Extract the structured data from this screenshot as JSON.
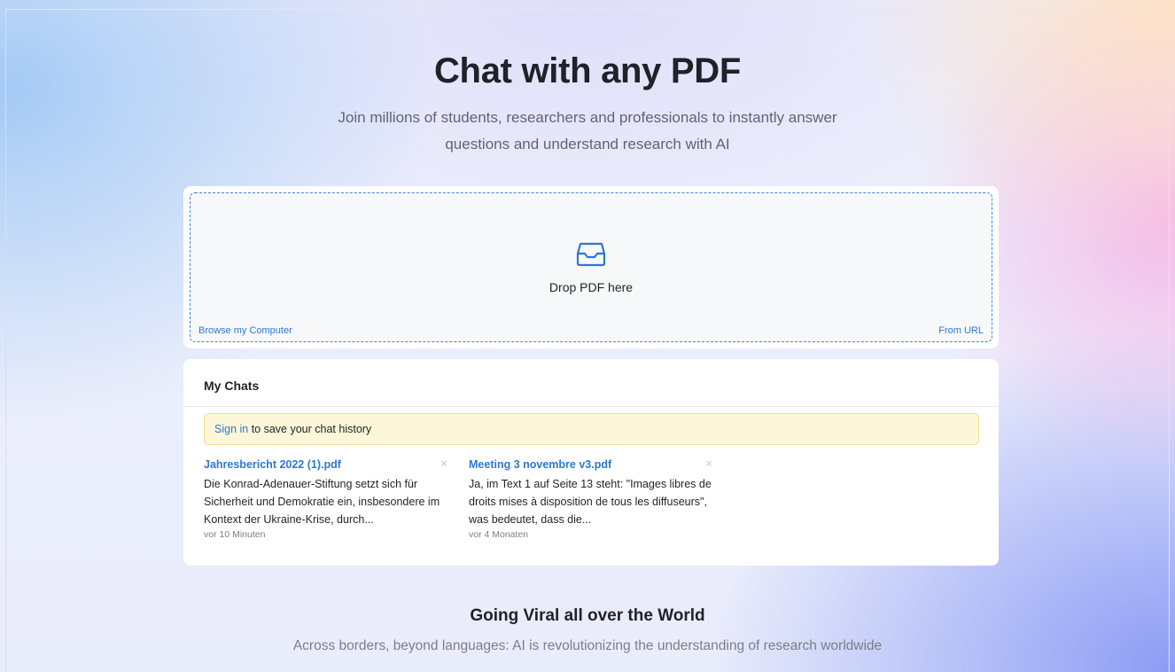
{
  "hero": {
    "title": "Chat with any PDF",
    "subtitle": "Join millions of students, researchers and professionals to instantly answer questions and understand research with AI"
  },
  "upload": {
    "icon": "inbox-icon",
    "drop_label": "Drop PDF here",
    "browse_label": "Browse my Computer",
    "url_label": "From URL"
  },
  "chats": {
    "heading": "My Chats",
    "signin_link": "Sign in",
    "signin_text": " to save your chat history",
    "items": [
      {
        "title": "Jahresbericht 2022 (1).pdf",
        "excerpt": "Die Konrad-Adenauer-Stiftung setzt sich für Sicherheit und Demokratie ein, insbesondere im Kontext der Ukraine-Krise, durch...",
        "time": "vor 10 Minuten",
        "close": "×"
      },
      {
        "title": "Meeting 3 novembre v3.pdf",
        "excerpt": "Ja, im Text 1 auf Seite 13 steht: \"Images libres de droits mises à disposition de tous les diffuseurs\", was bedeutet, dass die...",
        "time": "vor 4 Monaten",
        "close": "×"
      }
    ]
  },
  "viral": {
    "title": "Going Viral all over the World",
    "subtitle": "Across borders, beyond languages: AI is revolutionizing the understanding of research worldwide"
  },
  "colors": {
    "accent": "#2d78d0",
    "banner_bg": "#fdf6d8",
    "text": "#1f2328",
    "muted": "#7a7f88"
  }
}
